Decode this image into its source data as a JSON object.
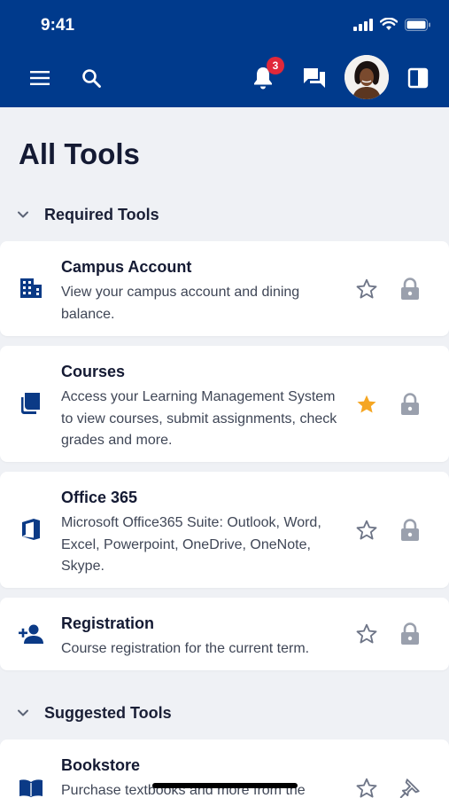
{
  "status_bar": {
    "time": "9:41"
  },
  "header": {
    "notification_count": "3"
  },
  "page": {
    "title": "All Tools"
  },
  "sections": {
    "required": {
      "label": "Required Tools"
    },
    "suggested": {
      "label": "Suggested Tools"
    }
  },
  "tools": [
    {
      "title": "Campus Account",
      "description": "View your campus account and dining balance.",
      "icon": "building-icon",
      "starred": false,
      "action": "lock"
    },
    {
      "title": "Courses",
      "description": "Access your Learning Management System to view courses, submit assignments, check grades and more.",
      "icon": "book-stack-icon",
      "starred": true,
      "action": "lock"
    },
    {
      "title": "Office 365",
      "description": "Microsoft Office365 Suite: Outlook, Word, Excel, Powerpoint, OneDrive, OneNote, Skype.",
      "icon": "office-icon",
      "starred": false,
      "action": "lock"
    },
    {
      "title": "Registration",
      "description": "Course registration for the current term.",
      "icon": "person-add-icon",
      "starred": false,
      "action": "lock"
    },
    {
      "title": "Bookstore",
      "description": "Purchase textbooks and more from the",
      "icon": "open-book-icon",
      "starred": false,
      "action": "pin"
    }
  ],
  "colors": {
    "header_bg": "#003a8c",
    "icon_blue": "#0b3a86",
    "badge_red": "#e0283a",
    "star_gold": "#f5a623",
    "muted_icon": "#9aa0ad"
  }
}
